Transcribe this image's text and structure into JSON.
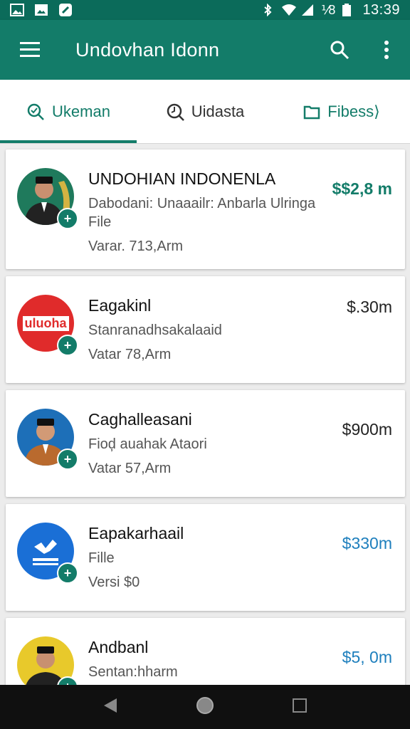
{
  "status": {
    "battery_percent": "⅟8",
    "time": "13:39"
  },
  "app_bar": {
    "title": "Undovhan Idonn"
  },
  "tabs": [
    {
      "label": "Ukeman",
      "icon": "search-chat-icon"
    },
    {
      "label": "Uidasta",
      "icon": "clock-search-icon"
    },
    {
      "label": "Fibess⟩",
      "icon": "folder-icon"
    }
  ],
  "items": [
    {
      "title": "UNDOHIAN INDONENLA",
      "sub1": "Dabodani: Unaaailr: Anbarla Ulringa",
      "sub2": "File",
      "meta": "Varar. 713,Arm",
      "price": "$$2,8 m",
      "price_color": "#137c69",
      "avatar": "person-avatar",
      "avatar_text": ""
    },
    {
      "title": "Eagakinl",
      "sub1": "Stanranadhsakalaaid",
      "sub2": "",
      "meta": "Vatar 78,Arm",
      "price": "$.30m",
      "price_color": "#222222",
      "avatar": "brand-logo-avatar",
      "avatar_text": "uluoha"
    },
    {
      "title": "Caghalleasani",
      "sub1": "Fioḑ auahak Ataori",
      "sub2": "",
      "meta": "Vatar 57,Arm",
      "price": "$900m",
      "price_color": "#222222",
      "avatar": "person-avatar",
      "avatar_text": ""
    },
    {
      "title": "Eapakarhaail",
      "sub1": "Fille",
      "sub2": "",
      "meta": "Versi $0",
      "price": "$330m",
      "price_color": "#1e7fbd",
      "avatar": "app-logo-avatar",
      "avatar_text": ""
    },
    {
      "title": "Andbanl",
      "sub1": "Sentan:hharm",
      "sub2": "",
      "meta": "",
      "price": "$5, 0m",
      "price_color": "#1e7fbd",
      "avatar": "person-avatar",
      "avatar_text": ""
    }
  ],
  "colors": {
    "primary": "#137c69",
    "status_bar": "#0b6b5a",
    "blue_price": "#1e7fbd"
  }
}
